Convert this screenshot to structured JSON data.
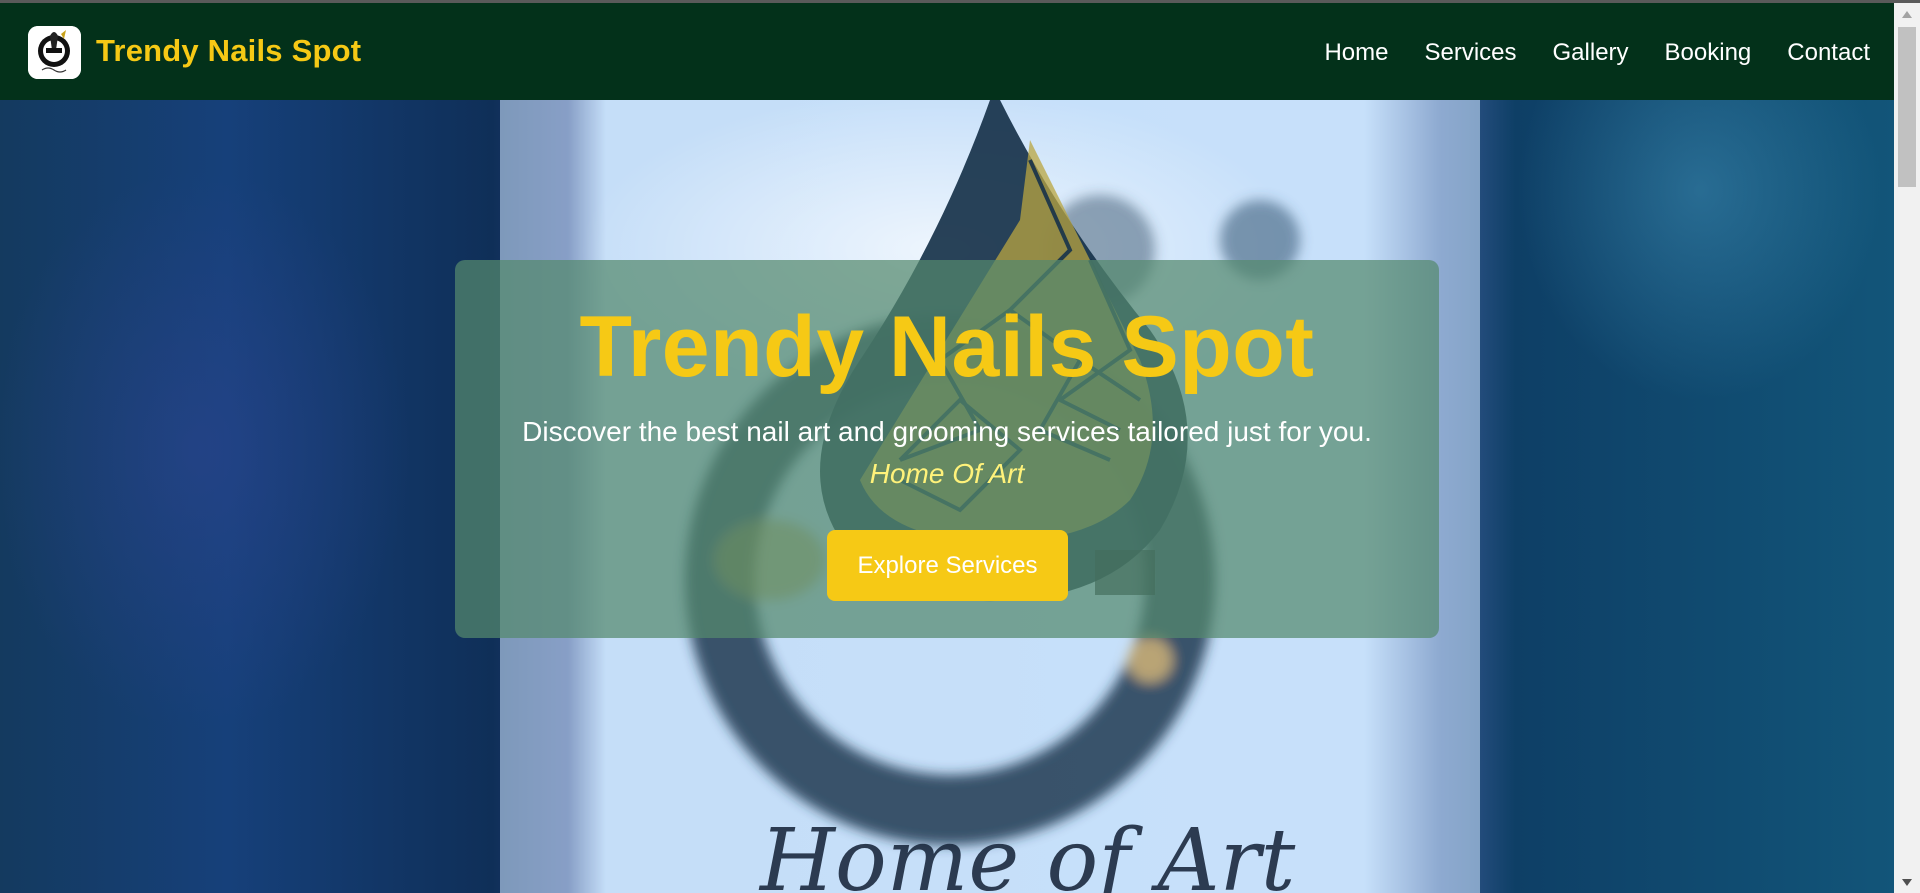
{
  "navbar": {
    "brand": "Trendy Nails Spot",
    "links": [
      "Home",
      "Services",
      "Gallery",
      "Booking",
      "Contact"
    ]
  },
  "hero": {
    "title": "Trendy Nails Spot",
    "subtitle": "Discover the best nail art and grooming services tailored just for you.",
    "tagline": "Home Of Art",
    "cta_label": "Explore Services",
    "background_script": "Home of Art"
  },
  "colors": {
    "navbar_bg": "#03311a",
    "accent_yellow": "#f6c915",
    "card_overlay": "#54896e"
  },
  "icons": {
    "logo": "nail-polish-drop-logo",
    "scroll_up": "triangle-up-icon",
    "scroll_down": "triangle-down-icon"
  }
}
